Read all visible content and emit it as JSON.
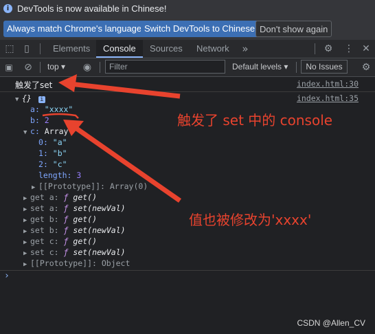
{
  "infobar": {
    "icon": "info-icon",
    "message": "DevTools is now available in Chinese!",
    "btn_match": "Always match Chrome's language",
    "btn_switch": "Switch DevTools to Chinese",
    "btn_dismiss": "Don't show again"
  },
  "tabs": [
    "Elements",
    "Console",
    "Sources",
    "Network"
  ],
  "toolbar": {
    "context": "top",
    "filter_placeholder": "Filter",
    "levels": "Default levels",
    "issues": "No Issues"
  },
  "console": {
    "line1_text": "触发了set",
    "line1_source": "index.html:30",
    "line2_source": "index.html:35",
    "object_open": "{}",
    "a_key": "a",
    "a_val": "\"xxxx\"",
    "b_key": "b",
    "b_val": "2",
    "c_key": "c",
    "c_type": "Array",
    "arr_items": [
      {
        "k": "0",
        "v": "\"a\""
      },
      {
        "k": "1",
        "v": "\"b\""
      },
      {
        "k": "2",
        "v": "\"c\""
      }
    ],
    "length_key": "length",
    "length_val": "3",
    "arr_proto": "[[Prototype]]: Array(0)",
    "accessors": [
      {
        "kind": "get",
        "name": "a",
        "sig": "get()"
      },
      {
        "kind": "set",
        "name": "a",
        "sig": "set(newVal)"
      },
      {
        "kind": "get",
        "name": "b",
        "sig": "get()"
      },
      {
        "kind": "set",
        "name": "b",
        "sig": "set(newVal)"
      },
      {
        "kind": "get",
        "name": "c",
        "sig": "get()"
      },
      {
        "kind": "set",
        "name": "c",
        "sig": "set(newVal)"
      }
    ],
    "obj_proto": "[[Prototype]]: Object",
    "f_symbol": "ƒ",
    "prompt": "›"
  },
  "annotations": {
    "first": "触发了 set 中的 console",
    "second": "值也被修改为'xxxx'",
    "color": "#e8432e"
  },
  "watermark": "CSDN @Allen_CV"
}
